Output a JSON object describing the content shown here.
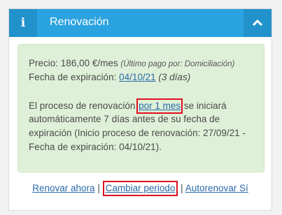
{
  "panel": {
    "title": "Renovación",
    "info_glyph": "i",
    "toggle_icon": "chevron-up-icon"
  },
  "details": {
    "price_label": "Precio:",
    "price_value": "186,00 €/mes",
    "last_payment_note": "(Último pago por: Domiciliación)",
    "expiry_label": "Fecha de expiración:",
    "expiry_date": "04/10/21",
    "expiry_days": "(3 días)",
    "renewal_text_before": "El proceso de renovación",
    "renewal_period": "por 1 mes",
    "renewal_text_after": "se iniciará",
    "renewal_line2": "automáticamente 7 días antes de su fecha de",
    "renewal_line3": "expiración (Inicio proceso de renovación: 27/09/21 -",
    "renewal_line4": "Fecha de expiración: 04/10/21)."
  },
  "actions": {
    "renew_now": "Renovar ahora",
    "separator": "|",
    "change_period": "Cambiar periodo",
    "auto_renew": "Autorenovar Sí"
  },
  "colors": {
    "header": "#2aa3e0",
    "header_dark": "#2292cc",
    "success_bg": "#dff0d8",
    "link": "#2a6aa8",
    "highlight_border": "#e01020"
  }
}
